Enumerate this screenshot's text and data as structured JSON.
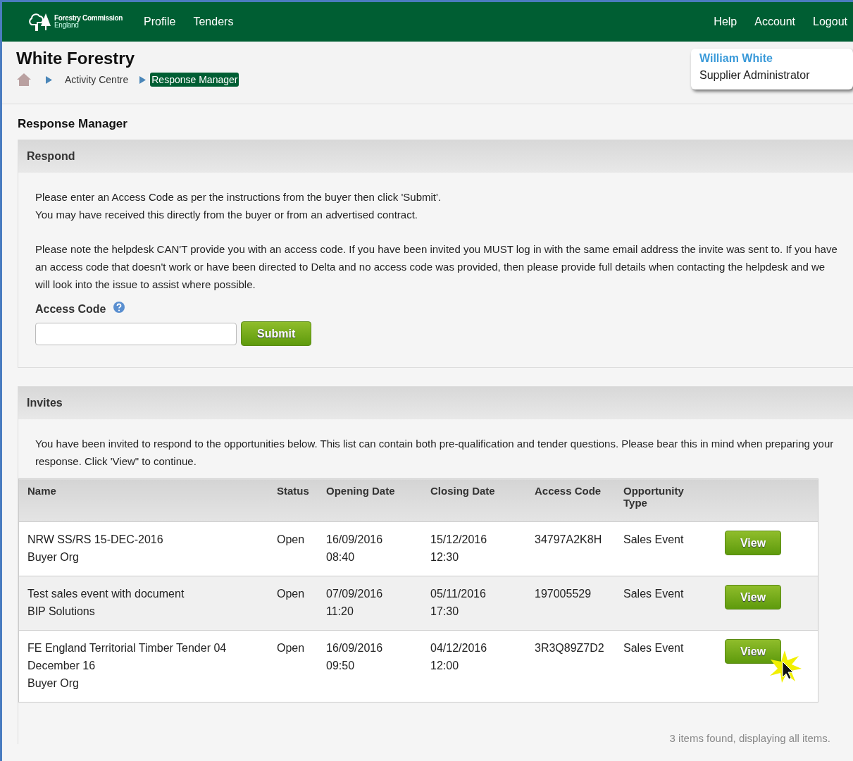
{
  "logo": {
    "name": "Forestry Commission",
    "region": "England"
  },
  "nav": [
    "Profile",
    "Tenders"
  ],
  "nav_right": [
    "Help",
    "Account",
    "Logout"
  ],
  "org_title": "White Forestry",
  "breadcrumbs": [
    {
      "label": "Activity Centre",
      "selected": false
    },
    {
      "label": "Response Manager",
      "selected": true
    }
  ],
  "user": {
    "name": "William White",
    "role": "Supplier Administrator"
  },
  "page_title": "Response Manager",
  "respond": {
    "heading": "Respond",
    "paragraphs": [
      "Please enter an Access Code as per the instructions from the buyer then click 'Submit'.\nYou may have received this directly from the buyer or from an advertised contract.",
      "Please note the helpdesk CAN'T provide you with an access code. If you have been invited you MUST log in with the same email address the invite was sent to. If you have an access code that doesn't work or have been directed to Delta and no access code was provided, then please provide full details when contacting the helpdesk and we will look into the issue to assist where possible."
    ],
    "field_label": "Access Code",
    "button": "Submit"
  },
  "invites": {
    "heading": "Invites",
    "intro": "You have been invited to respond to the opportunities below. This list can contain both pre-qualification and tender questions. Please bear this in mind when preparing your response. Click 'View\" to continue.",
    "columns": [
      "Name",
      "Status",
      "Opening Date",
      "Closing Date",
      "Access Code",
      "Opportunity Type"
    ],
    "rows": [
      {
        "name": "NRW SS/RS 15-DEC-2016",
        "org": "Buyer Org",
        "status": "Open",
        "opening": [
          "16/09/2016",
          "08:40"
        ],
        "closing": [
          "15/12/2016",
          "12:30"
        ],
        "code": "34797A2K8H",
        "type": "Sales Event",
        "action": "View",
        "hovered": false
      },
      {
        "name": "Test sales event with document",
        "org": "BIP Solutions",
        "status": "Open",
        "opening": [
          "07/09/2016",
          "11:20"
        ],
        "closing": [
          "05/11/2016",
          "17:30"
        ],
        "code": "197005529",
        "type": "Sales Event",
        "action": "View",
        "hovered": false
      },
      {
        "name": "FE England Territorial Timber Tender 04 December 16",
        "org": "Buyer Org",
        "status": "Open",
        "opening": [
          "16/09/2016",
          "09:50"
        ],
        "closing": [
          "04/12/2016",
          "12:00"
        ],
        "code": "3R3Q89Z7D2",
        "type": "Sales Event",
        "action": "View",
        "hovered": true
      }
    ],
    "footer": "3 items found, displaying all items."
  }
}
